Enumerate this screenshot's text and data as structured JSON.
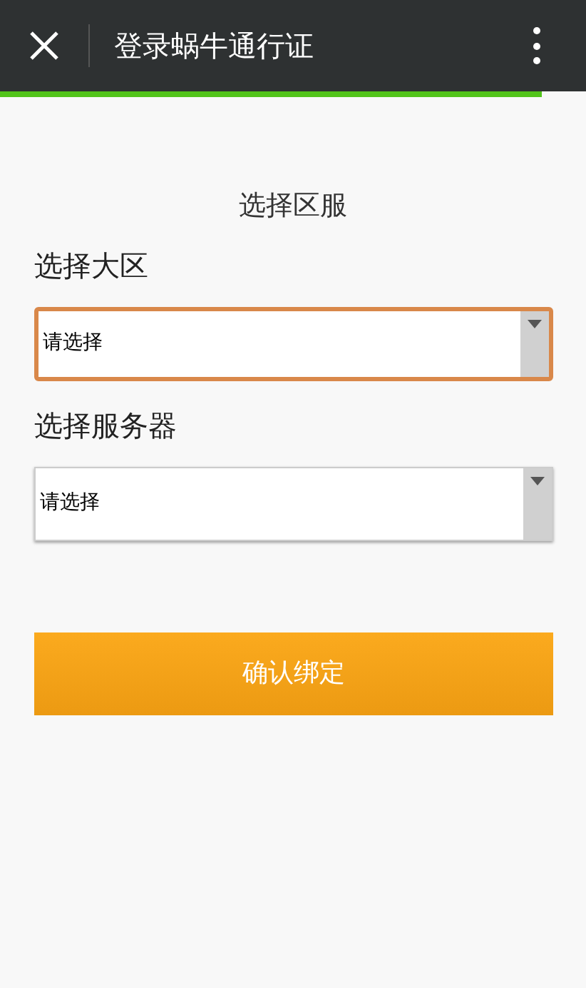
{
  "header": {
    "title": "登录蜗牛通行证"
  },
  "page_loading": {
    "level": 0.925
  },
  "form": {
    "title": "选择区服",
    "fields": [
      {
        "label": "选择大区",
        "value": "请选择",
        "focused": true
      },
      {
        "label": "选择服务器",
        "value": "请选择",
        "focused": false
      }
    ],
    "submit": "确认绑定"
  }
}
